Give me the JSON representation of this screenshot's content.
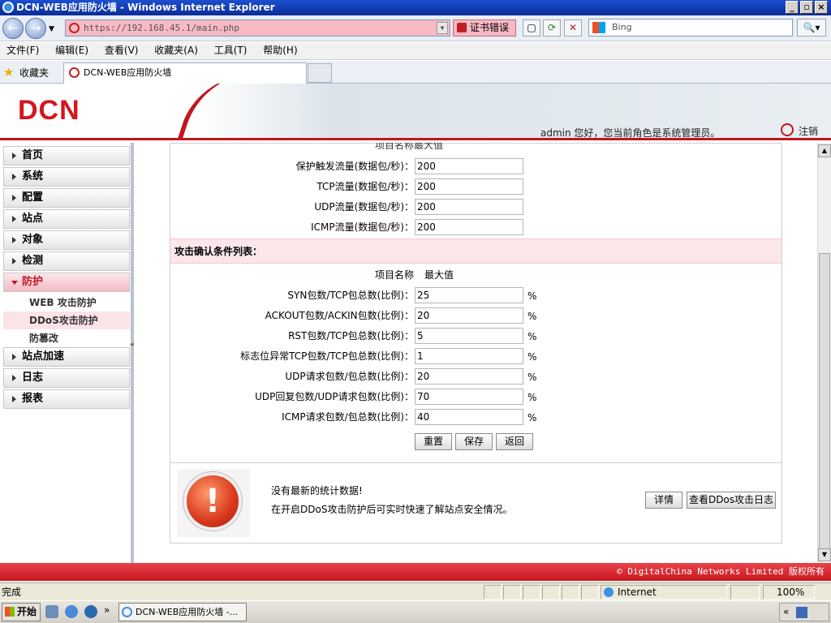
{
  "window": {
    "title": "DCN-WEB应用防火墙 - Windows Internet Explorer"
  },
  "addressbar": {
    "url": "https://192.168.45.1/main.php",
    "cert_error": "证书错误",
    "search_placeholder": "Bing"
  },
  "menu": [
    "文件(F)",
    "编辑(E)",
    "查看(V)",
    "收藏夹(A)",
    "工具(T)",
    "帮助(H)"
  ],
  "favorites": {
    "label": "收藏夹",
    "tab_title": "DCN-WEB应用防火墙"
  },
  "header": {
    "logo": "DCN",
    "welcome": "admin 您好，您当前角色是系统管理员。",
    "logout": "注销"
  },
  "sidebar": {
    "items": [
      {
        "label": "首页"
      },
      {
        "label": "系统"
      },
      {
        "label": "配置"
      },
      {
        "label": "站点"
      },
      {
        "label": "对象"
      },
      {
        "label": "检测"
      },
      {
        "label": "防护"
      }
    ],
    "subitems": [
      {
        "label": "WEB 攻击防护"
      },
      {
        "label": "DDoS攻击防护"
      },
      {
        "label": "防篡改"
      }
    ],
    "items_after": [
      {
        "label": "站点加速"
      },
      {
        "label": "日志"
      },
      {
        "label": "报表"
      }
    ]
  },
  "form": {
    "clipped_header": "项目名称最大值",
    "trigger_rows": [
      {
        "label": "保护触发流量(数据包/秒)：",
        "value": "200"
      },
      {
        "label": "TCP流量(数据包/秒)：",
        "value": "200"
      },
      {
        "label": "UDP流量(数据包/秒)：",
        "value": "200"
      },
      {
        "label": "ICMP流量(数据包/秒)：",
        "value": "200"
      }
    ],
    "section_title": "攻击确认条件列表：",
    "col_name": "项目名称",
    "col_max": "最大值",
    "confirm_rows": [
      {
        "label": "SYN包数/TCP包总数(比例)：",
        "value": "25",
        "unit": "%"
      },
      {
        "label": "ACKOUT包数/ACKIN包数(比例)：",
        "value": "20",
        "unit": "%"
      },
      {
        "label": "RST包数/TCP包总数(比例)：",
        "value": "5",
        "unit": "%"
      },
      {
        "label": "标志位异常TCP包数/TCP包总数(比例)：",
        "value": "1",
        "unit": "%"
      },
      {
        "label": "UDP请求包数/包总数(比例)：",
        "value": "20",
        "unit": "%"
      },
      {
        "label": "UDP回复包数/UDP请求包数(比例)：",
        "value": "70",
        "unit": "%"
      },
      {
        "label": "ICMP请求包数/包总数(比例)：",
        "value": "40",
        "unit": "%"
      }
    ],
    "buttons": {
      "reset": "重置",
      "save": "保存",
      "back": "返回"
    }
  },
  "stats": {
    "line1": "没有最新的统计数据!",
    "line2": "在开启DDoS攻击防护后可实时快速了解站点安全情况。",
    "detail_button": "详情",
    "log_button": "查看DDos攻击日志"
  },
  "footer": {
    "copyright": "© DigitalChina Networks Limited 版权所有"
  },
  "statusbar": {
    "status": "完成",
    "zone": "Internet",
    "zoom": "100%"
  },
  "taskbar": {
    "start": "开始",
    "task": "DCN-WEB应用防火墙 -..."
  },
  "colors": {
    "brand_red": "#c0161e",
    "section_bg": "#fbe6ea",
    "address_error_bg": "#f7b9c4"
  }
}
